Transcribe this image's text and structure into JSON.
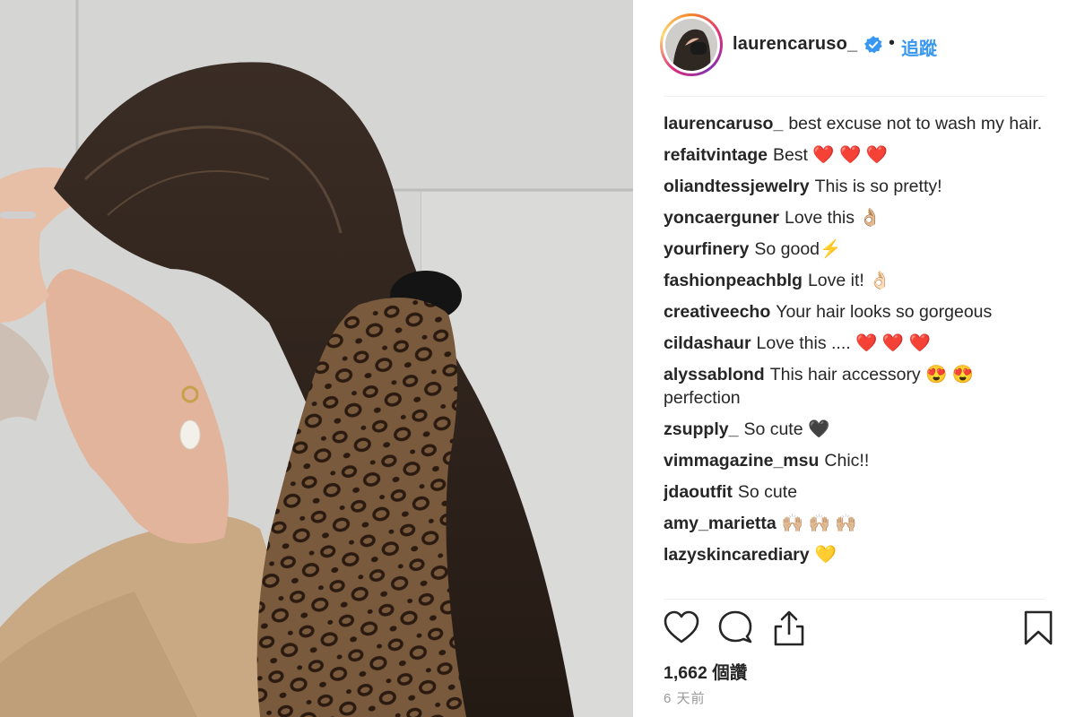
{
  "post": {
    "username": "laurencaruso_",
    "separator": "•",
    "follow_label": "追蹤",
    "likes": "1,662 個讚",
    "time_ago": "6 天前"
  },
  "comments": [
    {
      "user": "laurencaruso_",
      "text": "best excuse not to wash my hair."
    },
    {
      "user": "refaitvintage",
      "text": "Best ❤️ ❤️ ❤️"
    },
    {
      "user": "oliandtessjewelry",
      "text": "This is so pretty!"
    },
    {
      "user": "yoncaerguner",
      "text": "Love this 👌🏼"
    },
    {
      "user": "yourfinery",
      "text": "So good⚡"
    },
    {
      "user": "fashionpeachblg",
      "text": "Love it! 👌🏻"
    },
    {
      "user": "creativeecho",
      "text": "Your hair looks so gorgeous"
    },
    {
      "user": "cildashaur",
      "text": "Love this .... ❤️ ❤️ ❤️"
    },
    {
      "user": "alyssablond",
      "text": "This hair accessory 😍 😍 perfection"
    },
    {
      "user": "zsupply_",
      "text": "So cute 🖤"
    },
    {
      "user": "vimmagazine_msu",
      "text": "Chic!!"
    },
    {
      "user": "jdaoutfit",
      "text": "So cute"
    },
    {
      "user": "amy_marietta",
      "text": "🙌🏼 🙌🏼 🙌🏼"
    },
    {
      "user": "lazyskincarediary",
      "text": "💛"
    }
  ],
  "icons": {
    "verified": "verified-badge-icon",
    "like": "heart-icon",
    "comment": "comment-bubble-icon",
    "share": "share-icon",
    "save": "bookmark-icon"
  },
  "colors": {
    "accent": "#3897f0",
    "text": "#262626",
    "muted": "#999999"
  }
}
